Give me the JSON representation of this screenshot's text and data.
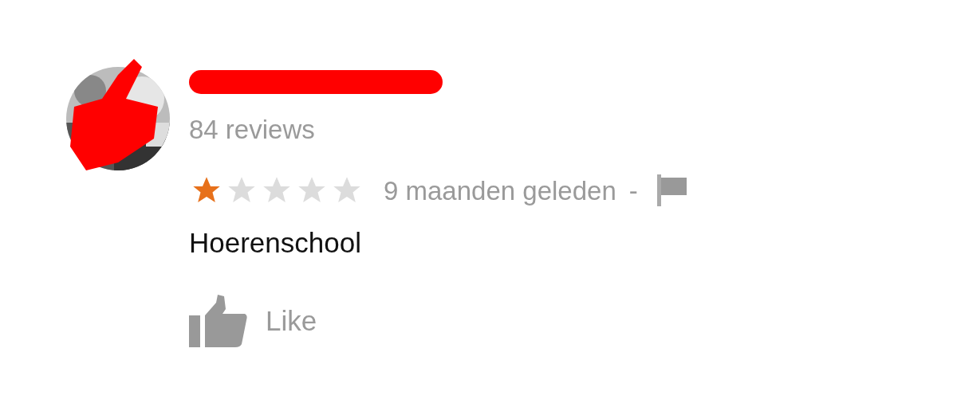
{
  "reviewer": {
    "review_count": "84 reviews"
  },
  "review": {
    "stars": 1,
    "time": "9 maanden geleden",
    "separator": "-",
    "text": "Hoerenschool"
  },
  "like": {
    "label": "Like"
  }
}
